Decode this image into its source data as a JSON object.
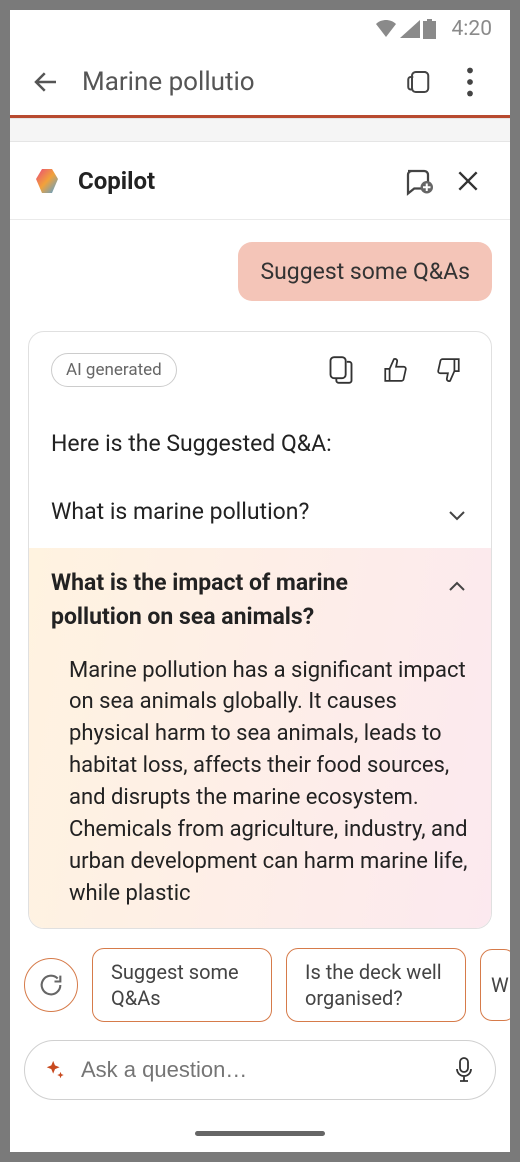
{
  "status": {
    "time": "4:20"
  },
  "appBar": {
    "title": "Marine pollutio"
  },
  "copilot": {
    "title": "Copilot"
  },
  "chat": {
    "userMessage": "Suggest some Q&As",
    "aiBadge": "AI generated",
    "intro": "Here is the Suggested Q&A:",
    "qa": [
      {
        "question": "What is marine pollution?",
        "expanded": false
      },
      {
        "question": "What is the impact of marine pollution on sea animals?",
        "expanded": true,
        "answer": "Marine pollution has a significant impact on sea animals globally. It causes physical harm to sea animals, leads to habitat loss, affects their food sources, and disrupts the marine ecosystem. Chemicals from agriculture, industry, and urban development can harm marine life, while plastic"
      }
    ]
  },
  "suggestions": [
    "Suggest some Q&As",
    "Is the deck well organised?",
    "W\nth"
  ],
  "input": {
    "placeholder": "Ask a question…"
  }
}
